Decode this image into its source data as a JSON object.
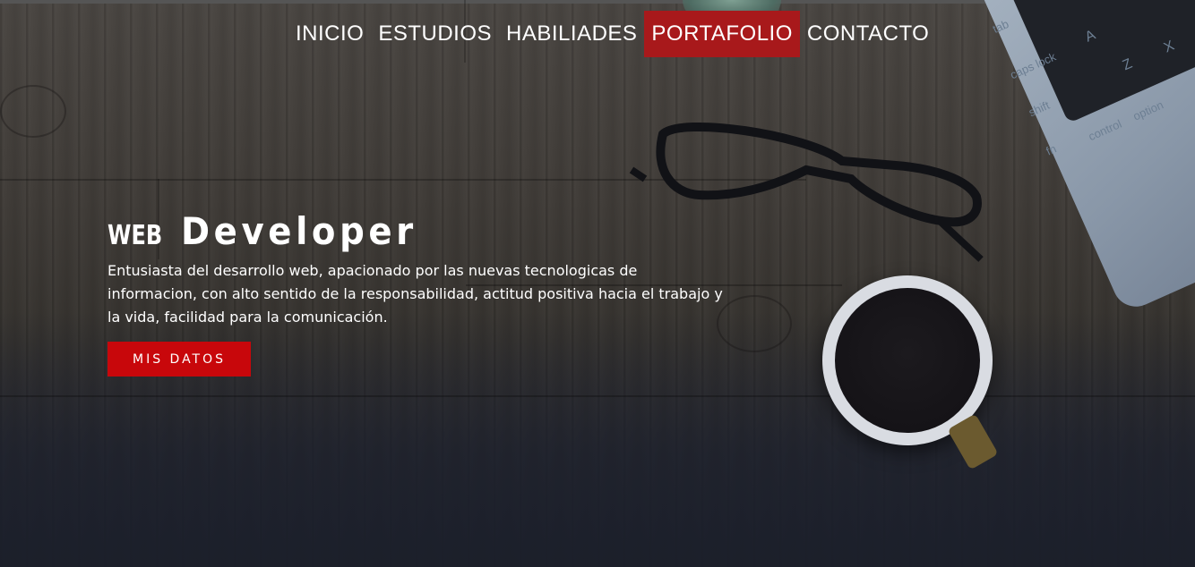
{
  "nav": {
    "items": [
      {
        "label": "INICIO",
        "active": false
      },
      {
        "label": "ESTUDIOS",
        "active": false
      },
      {
        "label": "HABILIADES",
        "active": false
      },
      {
        "label": "PORTAFOLIO",
        "active": true
      },
      {
        "label": "CONTACTO",
        "active": false
      }
    ]
  },
  "hero": {
    "title_small": "WEB",
    "title_big": "Developer",
    "description": "Entusiasta del desarrollo web, apacionado por las nuevas tecnologicas de informacion, con alto sentido de la responsabilidad, actitud positiva hacia el trabajo y la vida, facilidad para la comunicación.",
    "cta_label": "MIS DATOS"
  },
  "keyboard_keys": [
    "tab",
    "caps lock",
    "shift",
    "fn",
    "control",
    "option",
    "A",
    "Z",
    "X"
  ],
  "colors": {
    "active_nav": "#a8191b",
    "cta": "#c8070b",
    "text": "#ffffff"
  }
}
